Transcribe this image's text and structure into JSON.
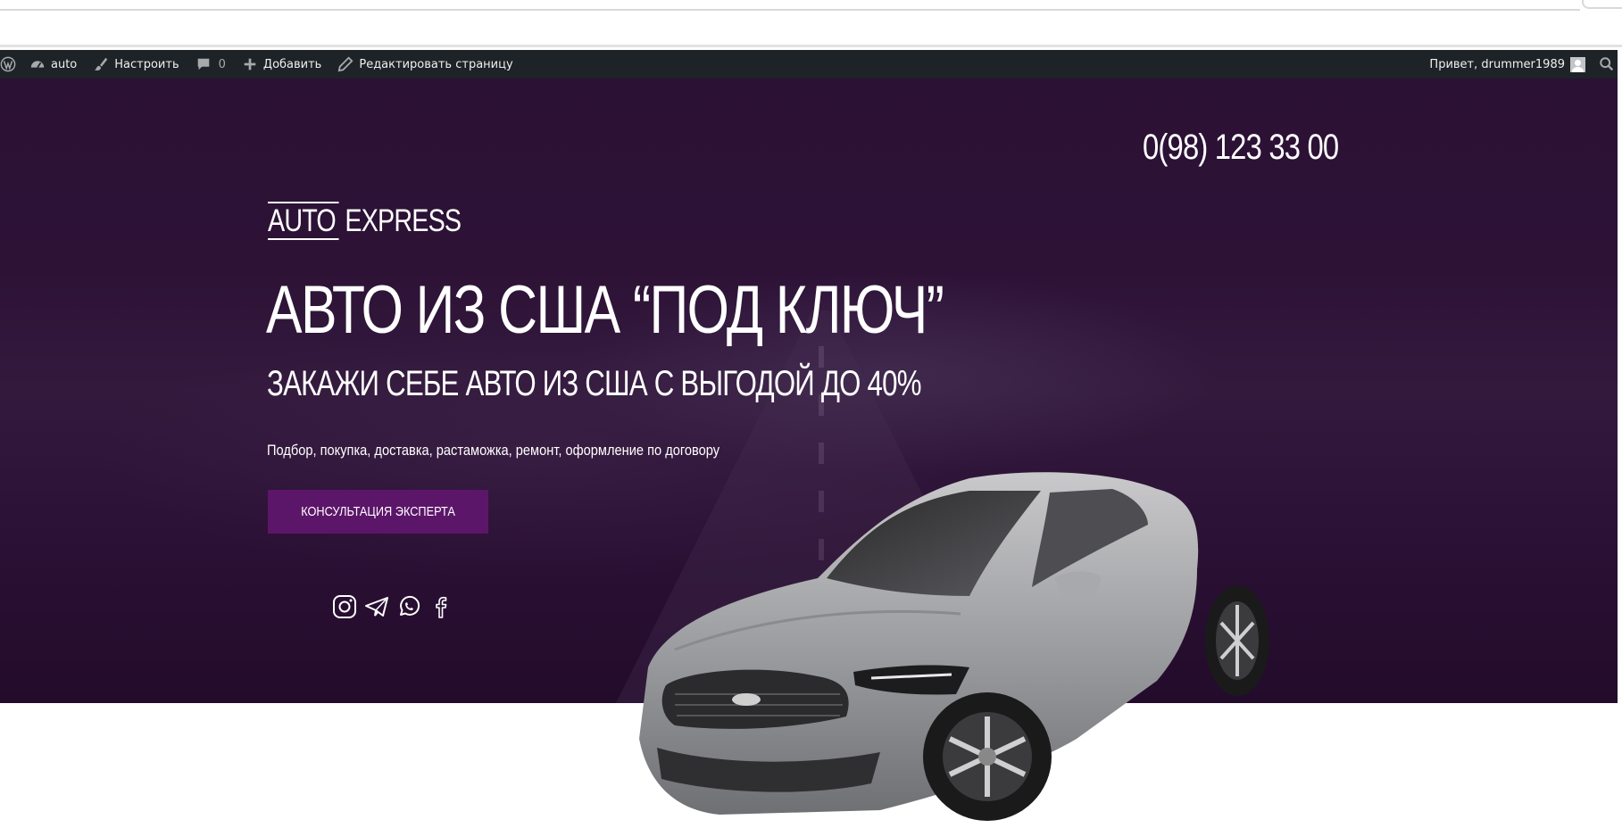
{
  "adminbar": {
    "site_name": "auto",
    "customize": "Настроить",
    "comments_count": "0",
    "add_new": "Добавить",
    "edit_page": "Редактировать страницу",
    "greeting": "Привет, drummer1989"
  },
  "header": {
    "logo_part1": "AUTO",
    "logo_part2": "EXPRESS",
    "phone": "0(98) 123 33 00"
  },
  "hero": {
    "title": "АВТО ИЗ США “ПОД КЛЮЧ”",
    "subtitle": "ЗАКАЖИ СЕБЕ АВТО ИЗ США С ВЫГОДОЙ ДО 40%",
    "description": "Подбор, покупка, доставка, растаможка, ремонт, оформление по договору",
    "cta_label": "КОНСУЛЬТАЦИЯ ЭКСПЕРТА"
  },
  "socials": [
    "instagram-icon",
    "telegram-icon",
    "whatsapp-icon",
    "facebook-icon"
  ],
  "colors": {
    "adminbar_bg": "#1d2327",
    "hero_bg": "#2b1134",
    "cta_bg": "#5c1669",
    "text": "#ffffff"
  }
}
